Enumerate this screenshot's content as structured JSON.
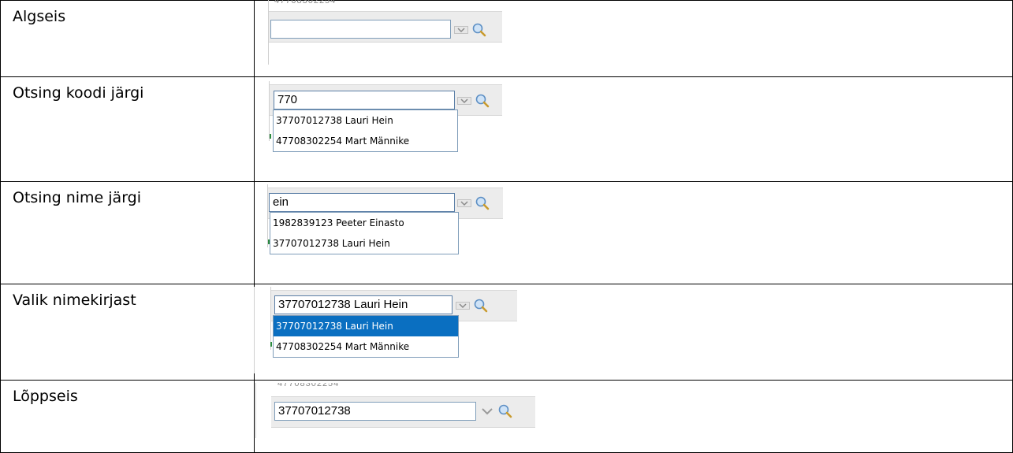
{
  "rows": [
    {
      "label": "Algseis",
      "value": "",
      "options": []
    },
    {
      "label": "Otsing koodi järgi",
      "value": "770",
      "options": [
        "37707012738 Lauri Hein",
        "47708302254 Mart Männike"
      ]
    },
    {
      "label": "Otsing nime järgi",
      "value": "ein",
      "options": [
        "1982839123 Peeter Einasto",
        "37707012738 Lauri Hein"
      ]
    },
    {
      "label": "Valik nimekirjast",
      "value": "37707012738 Lauri Hein",
      "options": [
        "37707012738 Lauri Hein",
        "47708302254 Mart Männike"
      ],
      "selected_option": 0
    },
    {
      "label": "Lõppseis",
      "value": "37707012738",
      "options": []
    }
  ],
  "icons": {
    "dropdown": "chevron-down-icon",
    "search": "magnifier-icon"
  },
  "colors": {
    "selected_option_bg": "#0a6fc1",
    "input_border": "#7f9db9",
    "toolbar_bg": "#ececec"
  }
}
